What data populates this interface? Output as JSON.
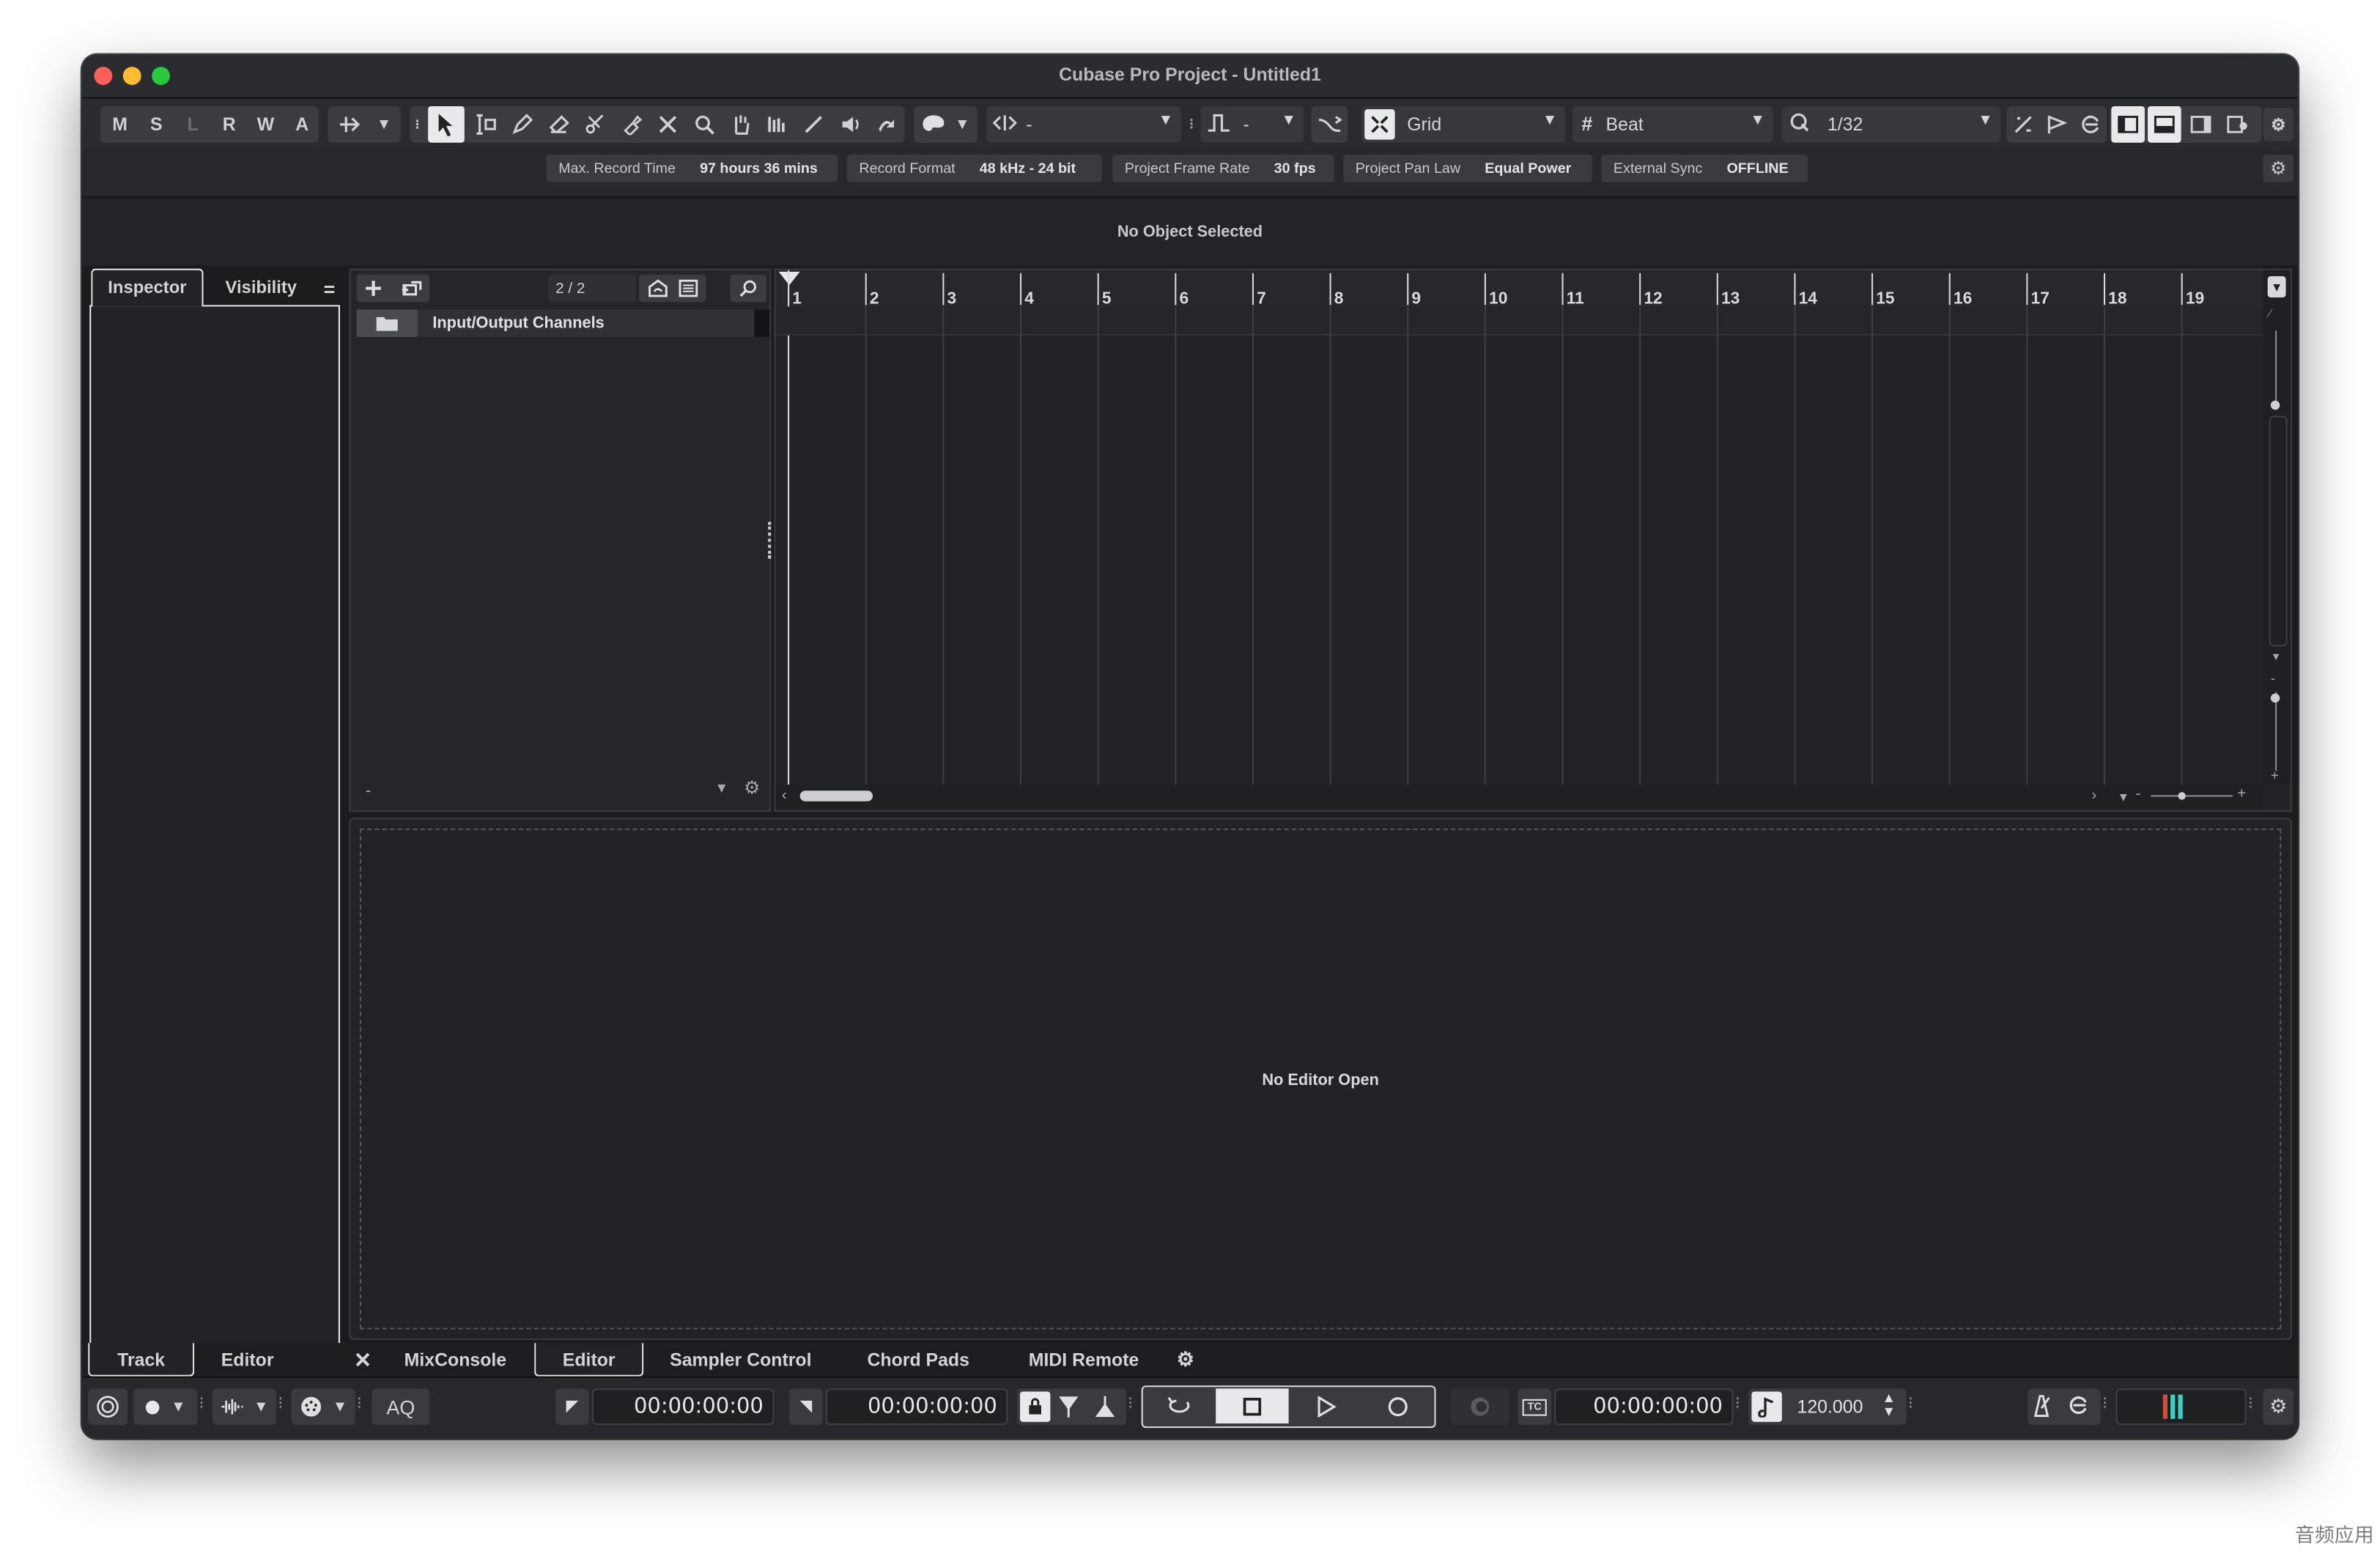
{
  "window": {
    "title": "Cubase Pro Project - Untitled1",
    "traffic_lights": [
      "#ff5f57",
      "#febc2e",
      "#28c840"
    ]
  },
  "toolbar": {
    "state_buttons": [
      "M",
      "S",
      "L",
      "R",
      "W",
      "A"
    ],
    "tool_icons": [
      "select-icon",
      "range-icon",
      "pencil-icon",
      "eraser-icon",
      "scissors-icon",
      "glue-icon",
      "mute-icon",
      "zoom-icon",
      "hand-icon",
      "comp-icon",
      "line-icon",
      "speaker-icon",
      "warp-icon"
    ],
    "nudge_value": "-",
    "quantize_length": "-",
    "snap_type": "Grid",
    "grid_type": "Beat",
    "quantize_value": "1/32"
  },
  "infobar": {
    "items": [
      {
        "label": "Max. Record Time",
        "value": "97 hours 36 mins"
      },
      {
        "label": "Record Format",
        "value": "48 kHz - 24 bit"
      },
      {
        "label": "Project Frame Rate",
        "value": "30 fps"
      },
      {
        "label": "Project Pan Law",
        "value": "Equal Power"
      },
      {
        "label": "External Sync",
        "value": "OFFLINE"
      }
    ]
  },
  "status": {
    "text": "No Object Selected"
  },
  "inspector": {
    "tabs": [
      "Inspector",
      "Visibility"
    ],
    "menu_icon": "="
  },
  "left_bottom_tabs": [
    "Track",
    "Editor"
  ],
  "track_list": {
    "count": "2 / 2",
    "folder_name": "Input/Output Channels",
    "minus": "-"
  },
  "ruler": {
    "bars": [
      "1",
      "2",
      "3",
      "4",
      "5",
      "6",
      "7",
      "8",
      "9",
      "10",
      "11",
      "12",
      "13",
      "14",
      "15",
      "16",
      "17",
      "18",
      "19"
    ]
  },
  "editor": {
    "text": "No Editor Open"
  },
  "lower_zone_tabs": [
    "MixConsole",
    "Editor",
    "Sampler Control",
    "Chord Pads",
    "MIDI Remote"
  ],
  "transport": {
    "aq_label": "AQ",
    "left_locator": "00:00:00:00",
    "right_locator": "00:00:00:00",
    "primary_time": "00:00:00:00",
    "tempo": "120.000",
    "tc_label": "TC"
  },
  "watermark": "音频应用"
}
